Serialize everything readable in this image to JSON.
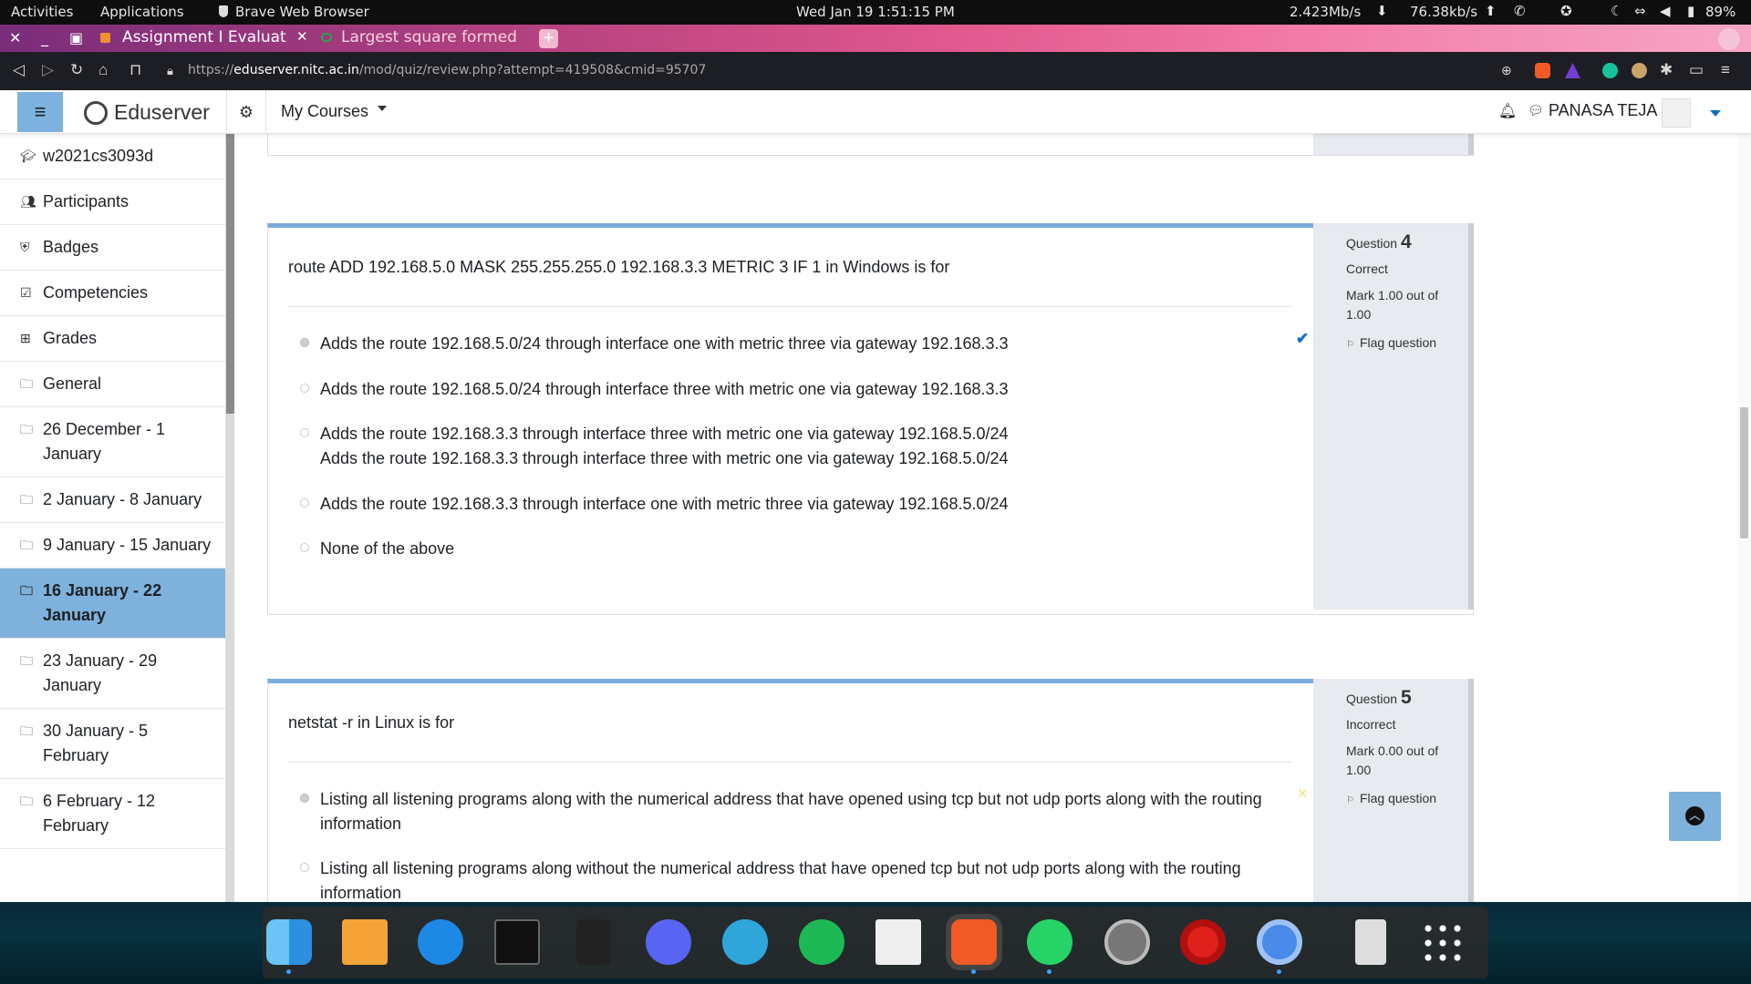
{
  "system_bar": {
    "activities": "Activities",
    "applications": "Applications",
    "browser": "Brave Web Browser",
    "datetime": "Wed Jan 19  1:51:15 PM",
    "download_speed": "2.423Mb/s",
    "upload_speed": "76.38kb/s",
    "battery": "89%"
  },
  "browser": {
    "tabs": [
      {
        "title": "Assignment I Evaluat",
        "active": true
      },
      {
        "title": "Largest square formed",
        "active": false
      }
    ],
    "url_prefix": "https://",
    "url_host": "eduserver.nitc.ac.in",
    "url_path": "/mod/quiz/review.php?attempt=419508&cmid=95707"
  },
  "moodle_nav": {
    "brand": "Eduserver",
    "my_courses": "My Courses",
    "user_name": "PANASA TEJA"
  },
  "sidebar": {
    "items": [
      {
        "label": "w2021cs3093d",
        "icon": "graduation-cap-icon",
        "active": false
      },
      {
        "label": "Participants",
        "icon": "users-icon",
        "active": false
      },
      {
        "label": "Badges",
        "icon": "shield-icon",
        "active": false
      },
      {
        "label": "Competencies",
        "icon": "check-square-icon",
        "active": false
      },
      {
        "label": "Grades",
        "icon": "table-icon",
        "active": false
      },
      {
        "label": "General",
        "icon": "folder-icon",
        "active": false
      },
      {
        "label": "26 December - 1 January",
        "icon": "folder-icon",
        "active": false
      },
      {
        "label": "2 January - 8 January",
        "icon": "folder-icon",
        "active": false
      },
      {
        "label": "9 January - 15 January",
        "icon": "folder-icon",
        "active": false
      },
      {
        "label": "16 January - 22 January",
        "icon": "folder-icon",
        "active": true
      },
      {
        "label": "23 January - 29 January",
        "icon": "folder-icon",
        "active": false
      },
      {
        "label": "30 January - 5 February",
        "icon": "folder-icon",
        "active": false
      },
      {
        "label": "6 February - 12 February",
        "icon": "folder-icon",
        "active": false
      }
    ]
  },
  "questions": [
    {
      "label": "Question",
      "number": "4",
      "state": "Correct",
      "mark": "Mark 1.00 out of 1.00",
      "flag": "Flag question",
      "text": "route ADD 192.168.5.0 MASK 255.255.255.0 192.168.3.3 METRIC 3 IF 1 in Windows is for",
      "options": [
        "Adds the route 192.168.5.0/24 through interface one with metric three via gateway 192.168.3.3",
        "Adds the route 192.168.5.0/24 through interface three with metric one via gateway 192.168.3.3",
        "Adds the route 192.168.3.3 through interface three with metric one via gateway 192.168.5.0/24",
        "Adds the route 192.168.3.3 through interface three with metric one via gateway 192.168.5.0/24",
        "Adds the route 192.168.3.3 through interface one with metric three via gateway 192.168.5.0/24",
        "None of the above"
      ],
      "selected_index": 0
    },
    {
      "label": "Question",
      "number": "5",
      "state": "Incorrect",
      "mark": "Mark 0.00 out of 1.00",
      "flag": "Flag question",
      "text": "netstat -r in Linux is for",
      "options": [
        "Listing all listening programs along with the numerical address that have opened using tcp but not udp ports along with the routing information",
        "Listing all listening programs along without the numerical address that have opened tcp but not udp ports along with the routing information"
      ],
      "selected_index": 0
    }
  ],
  "dock": {
    "apps": [
      "finder-icon",
      "pages-icon",
      "app-store-icon",
      "terminal-icon",
      "calculator-icon",
      "discord-icon",
      "telegram-icon",
      "spotify-icon",
      "notes-icon",
      "brave-icon",
      "whatsapp-icon",
      "settings-icon",
      "opera-icon",
      "chromium-icon",
      "trash-icon",
      "app-grid-icon"
    ]
  }
}
